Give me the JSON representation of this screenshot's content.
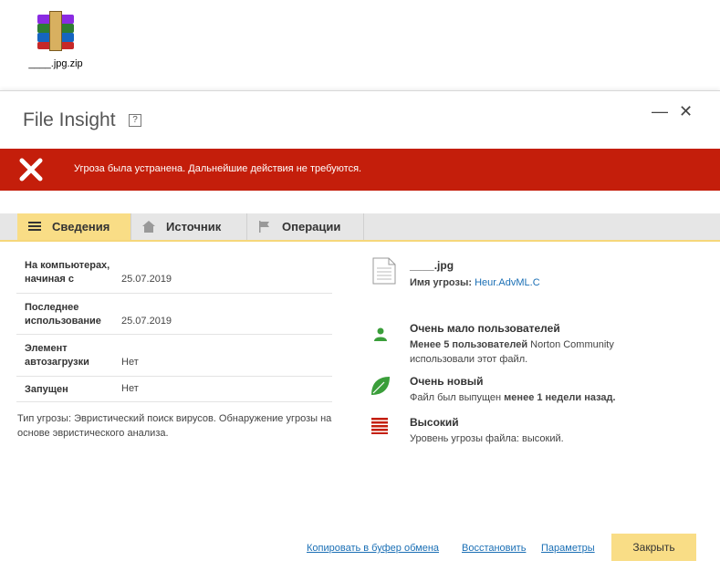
{
  "desktop": {
    "file_label": "____.jpg.zip",
    "icon": "winrar-archive-icon"
  },
  "window": {
    "title": "File Insight",
    "help_label": "?",
    "minimize_label": "—",
    "close_label": "✕"
  },
  "alert": {
    "message": "Угроза была устранена. Дальнейшие действия не требуются.",
    "color": "#c41e0b"
  },
  "tabs": [
    {
      "label": "Сведения",
      "icon": "list-icon",
      "active": true
    },
    {
      "label": "Источник",
      "icon": "home-icon",
      "active": false
    },
    {
      "label": "Операции",
      "icon": "flag-icon",
      "active": false
    }
  ],
  "details": [
    {
      "key_line1": "На компьютерах,",
      "key_line2": "начиная с",
      "value": "25.07.2019"
    },
    {
      "key_line1": "Последнее",
      "key_line2": "использование",
      "value": "25.07.2019"
    },
    {
      "key_line1": "Элемент",
      "key_line2": "автозагрузки",
      "value": "Нет"
    },
    {
      "key_line1": "Запущен",
      "key_line2": "",
      "value": "Нет"
    }
  ],
  "note": "Тип угрозы: Эвристический поиск вирусов. Обнаружение угрозы на основе эвристического анализа.",
  "file": {
    "name": "____.jpg",
    "threat_label": "Имя угрозы:",
    "threat_name": "Heur.AdvML.C"
  },
  "insights": {
    "users": {
      "title": "Очень мало пользователей",
      "bold": "Менее 5 пользователей",
      "text": " Norton Community",
      "text2": "использовали этот файл."
    },
    "age": {
      "title": "Очень новый",
      "text": "Файл был выпущен ",
      "bold": "менее 1 недели назад."
    },
    "risk": {
      "title": "Высокий",
      "text": "Уровень угрозы файла: высокий."
    }
  },
  "footer": {
    "copy_link": "Копировать в буфер обмена",
    "restore_link": "Восстановить",
    "settings_link": "Параметры",
    "close_button": "Закрыть"
  },
  "colors": {
    "accent": "#f9dd86",
    "danger": "#c41e0b",
    "link": "#1a6fb5",
    "green": "#3a9e3a"
  }
}
